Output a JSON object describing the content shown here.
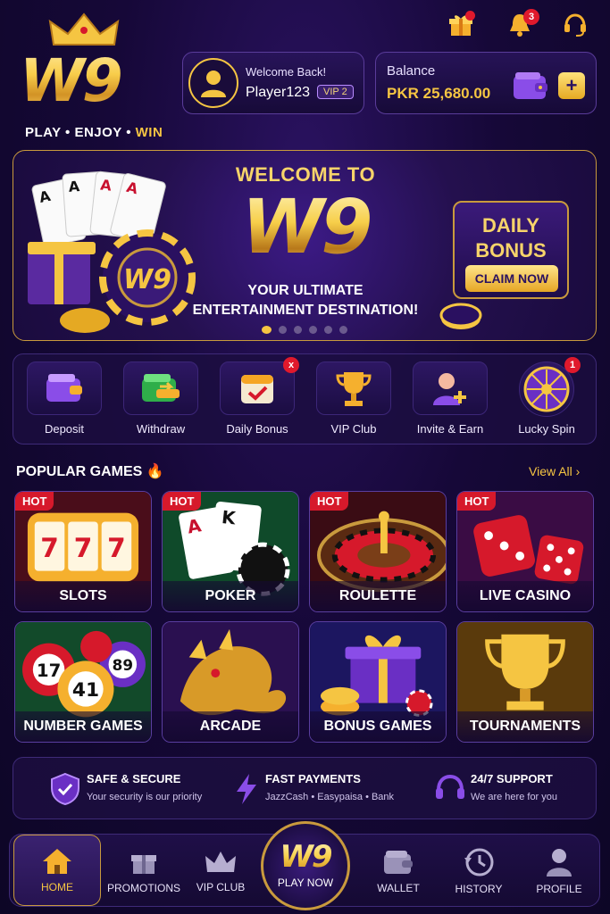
{
  "brand": {
    "logo_text": "W9",
    "tagline_part1": "PLAY • ENJOY • ",
    "tagline_win": "WIN"
  },
  "header": {
    "notification_count": "3"
  },
  "user": {
    "welcome": "Welcome Back!",
    "name": "Player123",
    "vip": "VIP 2"
  },
  "balance": {
    "label": "Balance",
    "value": "PKR 25,680.00",
    "add_label": "+"
  },
  "banner": {
    "welcome": "WELCOME TO",
    "logo": "W9",
    "subtitle_line1": "YOUR ULTIMATE",
    "subtitle_line2": "ENTERTAINMENT DESTINATION!",
    "daily_bonus": "DAILY BONUS",
    "claim": "CLAIM NOW",
    "slides": 6,
    "active_slide": 0
  },
  "actions": [
    {
      "label": "Deposit",
      "icon": "wallet-icon"
    },
    {
      "label": "Withdraw",
      "icon": "withdraw-icon"
    },
    {
      "label": "Daily Bonus",
      "icon": "calendar-icon",
      "badge": "x"
    },
    {
      "label": "VIP Club",
      "icon": "trophy-icon"
    },
    {
      "label": "Invite & Earn",
      "icon": "invite-icon"
    },
    {
      "label": "Lucky Spin",
      "icon": "wheel-icon",
      "badge": "1"
    }
  ],
  "popular": {
    "title": "POPULAR GAMES",
    "view_all": "View All"
  },
  "games": [
    {
      "name": "SLOTS",
      "hot": "HOT"
    },
    {
      "name": "POKER",
      "hot": "HOT"
    },
    {
      "name": "ROULETTE",
      "hot": "HOT"
    },
    {
      "name": "LIVE CASINO",
      "hot": "HOT"
    },
    {
      "name": "NUMBER GAMES"
    },
    {
      "name": "ARCADE"
    },
    {
      "name": "BONUS GAMES"
    },
    {
      "name": "TOURNAMENTS"
    }
  ],
  "features": [
    {
      "title": "SAFE & SECURE",
      "sub": "Your security is our priority"
    },
    {
      "title": "FAST PAYMENTS",
      "sub": "JazzCash • Easypaisa • Bank"
    },
    {
      "title": "24/7 SUPPORT",
      "sub": "We are here for you"
    }
  ],
  "nav": {
    "home": "HOME",
    "promotions": "PROMOTIONS",
    "vip": "VIP CLUB",
    "play_logo": "W9",
    "play": "PLAY NOW",
    "wallet": "WALLET",
    "history": "HISTORY",
    "profile": "PROFILE"
  },
  "colors": {
    "accent_gold": "#f5c542",
    "background": "#160838",
    "hot_red": "#d6192b"
  }
}
